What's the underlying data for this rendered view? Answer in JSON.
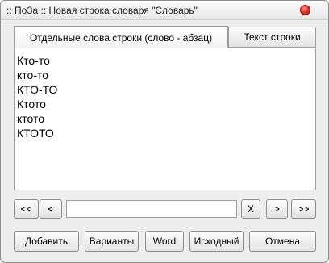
{
  "window": {
    "title": ":: ПоЗа :: Новая строка словаря \"Словарь\""
  },
  "tabs": [
    {
      "label": "Отдельные слова строки (слово - абзац)",
      "active": true
    },
    {
      "label": "Текст строки",
      "active": false
    }
  ],
  "text_lines": [
    "Кто-то",
    "кто-то",
    "КТО-ТО",
    "Ктото",
    "ктото",
    "КТОТО"
  ],
  "navigation": {
    "first_label": "<<",
    "prev_label": "<",
    "input_value": "",
    "clear_label": "X",
    "next_label": ">",
    "last_label": ">>"
  },
  "actions": {
    "add_label": "Добавить",
    "variants_label": "Варианты",
    "word_label": "Word",
    "original_label": "Исходный",
    "cancel_label": "Отмена"
  },
  "colors": {
    "close_button": "#e8362a",
    "window_background": "#ededed"
  }
}
